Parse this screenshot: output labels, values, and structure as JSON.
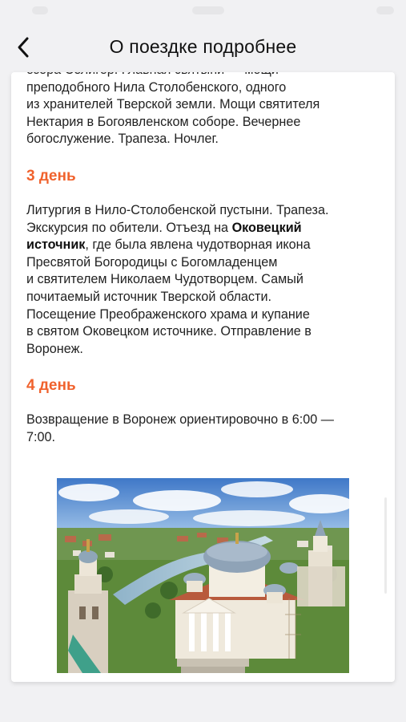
{
  "nav": {
    "title": "О поездке подробнее"
  },
  "content": {
    "intro_lines": [
      "озера Селигер. Главная святыни — мощи",
      "преподобного Нила Столобенского, одного",
      "из хранителей Тверской земли. Мощи святителя",
      "Нектария в Богоявленском соборе. Вечернее",
      "богослужение. Трапеза. Ночлег."
    ],
    "day3": {
      "heading": "3 день",
      "line1": "Литургия в Нило-Столобенской пустыни. Трапеза.",
      "line2_pre": "Экскурсия по обители. Отъезд на ",
      "line2_bold": "Оковецкий",
      "line3_bold": "источник",
      "line3_post": ", где была явлена чудотворная икона",
      "rest_lines": [
        "Пресвятой Богородицы с Богомладенцем",
        "и святителем Николаем Чудотворцем. Самый",
        "почитаемый источник Тверской области.",
        "Посещение Преображенского храма и купание",
        "в святом Оковецком источнике. Отправление в",
        "Воронеж."
      ]
    },
    "day4": {
      "heading": "4 день",
      "lines": [
        "Возвращение в Воронеж ориентировочно в 6:00 —",
        "7:00."
      ]
    }
  },
  "colors": {
    "accent": "#f0622d",
    "background": "#f1f1f3",
    "card": "#ffffff"
  },
  "icons": {
    "back": "chevron-left-icon"
  }
}
